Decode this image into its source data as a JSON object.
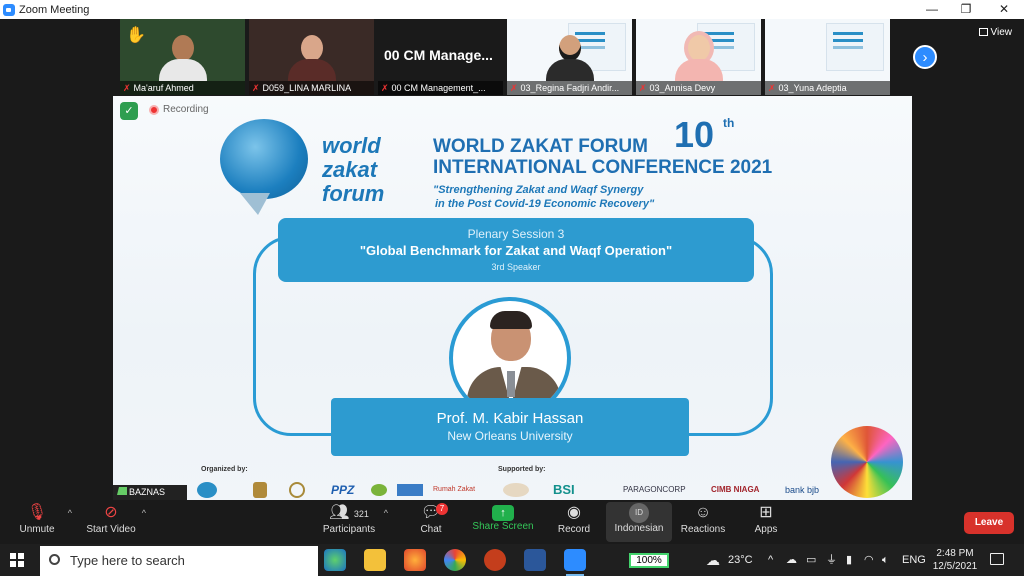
{
  "window": {
    "title": "Zoom Meeting",
    "min": "—",
    "restore": "❐",
    "close": "✕"
  },
  "strip": {
    "participants": [
      {
        "name": "Ma'aruf Ahmed",
        "hand": "✋"
      },
      {
        "name": "D059_LINA MARLINA"
      },
      {
        "name": "00 CM Management_...",
        "big_text": "00 CM Manage..."
      },
      {
        "name": "03_Regina Fadjri Andir..."
      },
      {
        "name": "03_Annisa Devy"
      },
      {
        "name": "03_Yuna Adeptia"
      }
    ],
    "next_icon": "›",
    "view_label": "View"
  },
  "share": {
    "recording_label": "Recording",
    "logo_lines": [
      "world",
      "zakat",
      "forum"
    ],
    "heading_line1": "WORLD ZAKAT FORUM",
    "heading_num": "10",
    "heading_sup": "th",
    "heading_line2": "INTERNATIONAL CONFERENCE 2021",
    "tagline1": "\"Strengthening Zakat and Waqf Synergy",
    "tagline2": "in the Post Covid-19 Economic Recovery\"",
    "session_line1": "Plenary Session 3",
    "session_line2": "\"Global Benchmark for Zakat and Waqf Operation\"",
    "session_line3": "3rd Speaker",
    "speaker_name": "Prof. M. Kabir Hassan",
    "speaker_affiliation": "New Orleans University",
    "organized_by": "Organized by:",
    "supported_by": "Supported by:",
    "logos": [
      "PPZ",
      "Rumah Zakat",
      "BSI",
      "PARAGONCORP",
      "CIMB NIAGA",
      "bank bjb"
    ],
    "presenter_label": "BAZNAS"
  },
  "toolbar": {
    "unmute": "Unmute",
    "start_video": "Start Video",
    "participants": "Participants",
    "participants_count": "321",
    "chat": "Chat",
    "chat_badge": "7",
    "share_screen": "Share Screen",
    "record": "Record",
    "language": "Indonesian",
    "language_code": "ID",
    "reactions": "Reactions",
    "apps": "Apps",
    "leave": "Leave"
  },
  "taskbar": {
    "search_placeholder": "Type here to search",
    "zoom_level": "100%",
    "temperature": "23°C",
    "lang": "ENG",
    "time": "2:48 PM",
    "date": "12/5/2021"
  },
  "colors": {
    "zoom_blue": "#2d8cff",
    "slide_blue": "#2d9bd0",
    "leave_red": "#d8322b",
    "share_green": "#21b04c"
  }
}
